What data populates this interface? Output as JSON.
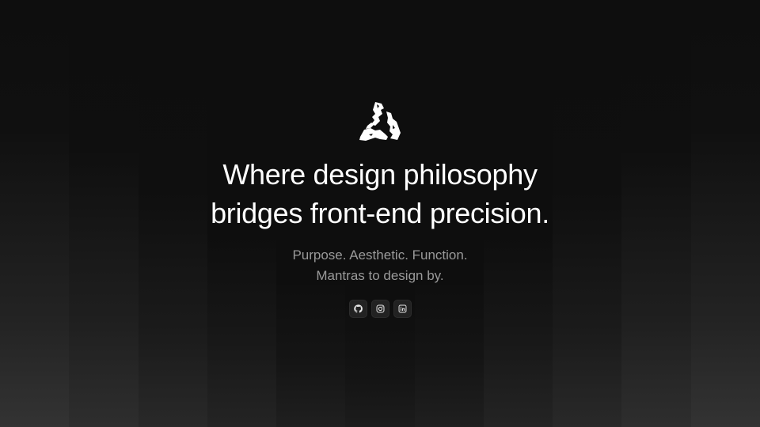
{
  "hero": {
    "logo_icon": "tri-swirl-logo-icon",
    "headline_line1": "Where design philosophy",
    "headline_line2": "bridges front-end precision.",
    "subtitle_line1": "Purpose. Aesthetic. Function.",
    "subtitle_line2": "Mantras to design by."
  },
  "socials": [
    {
      "icon": "github-icon"
    },
    {
      "icon": "instagram-icon"
    },
    {
      "icon": "linkedin-icon"
    }
  ],
  "colors": {
    "background": "#0e0e0e",
    "headline": "#ffffff",
    "subtitle": "#9a9a9a",
    "social_button": "#222222"
  }
}
